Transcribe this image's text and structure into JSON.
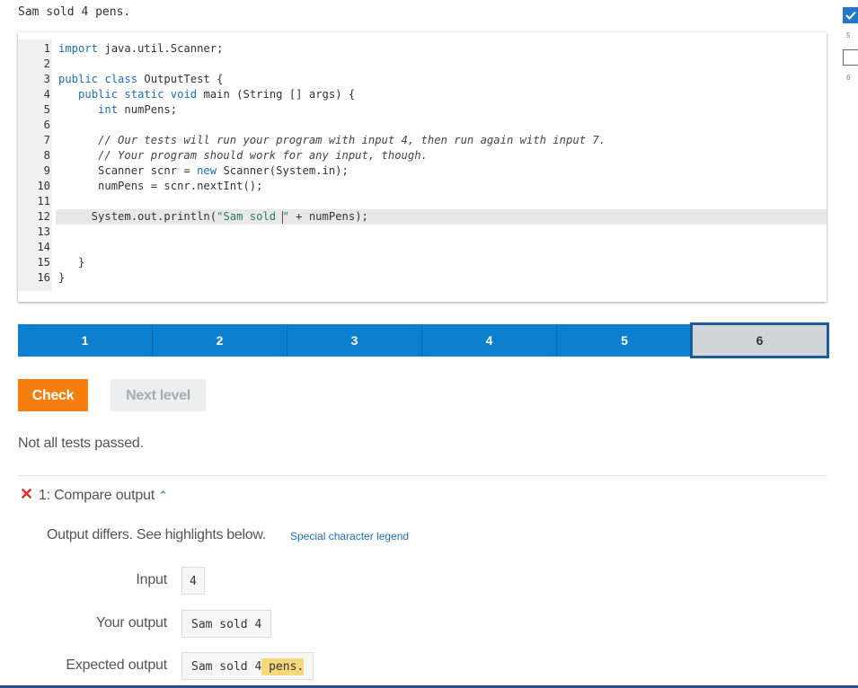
{
  "prompt": "Sam sold 4 pens.",
  "side_panel": {
    "items": [
      {
        "checked": true,
        "number": "5"
      },
      {
        "checked": false,
        "number": "6"
      }
    ]
  },
  "editor": {
    "lines": [
      {
        "n": "1",
        "code": "import java.util.Scanner;"
      },
      {
        "n": "2",
        "code": ""
      },
      {
        "n": "3",
        "code": "public class OutputTest {"
      },
      {
        "n": "4",
        "code": "   public static void main (String [] args) {"
      },
      {
        "n": "5",
        "code": "      int numPens;"
      },
      {
        "n": "6",
        "code": ""
      },
      {
        "n": "7",
        "code": "      // Our tests will run your program with input 4, then run again with input 7."
      },
      {
        "n": "8",
        "code": "      // Your program should work for any input, though."
      },
      {
        "n": "9",
        "code": "      Scanner scnr = new Scanner(System.in);"
      },
      {
        "n": "10",
        "code": "      numPens = scnr.nextInt();"
      },
      {
        "n": "11",
        "code": ""
      },
      {
        "n": "12",
        "code": "     System.out.println(\"Sam sold \" + numPens);"
      },
      {
        "n": "13",
        "code": ""
      },
      {
        "n": "14",
        "code": ""
      },
      {
        "n": "15",
        "code": "   }"
      },
      {
        "n": "16",
        "code": "}"
      }
    ],
    "active_line": "12"
  },
  "levels": {
    "items": [
      "1",
      "2",
      "3",
      "4",
      "5",
      "6"
    ],
    "current": "6"
  },
  "buttons": {
    "check": "Check",
    "next_level": "Next level"
  },
  "result": "Not all tests passed.",
  "test": {
    "title": "1: Compare output",
    "message": "Output differs. See highlights below.",
    "legend_link": "Special character legend",
    "input_label": "Input",
    "input_value": "4",
    "your_output_label": "Your output",
    "your_output_value": "Sam sold 4",
    "expected_label": "Expected output",
    "expected_value_prefix": "Sam sold 4",
    "expected_value_highlight": " pens."
  },
  "colors": {
    "accent": "#0c7fcf",
    "check_button": "#f47f0e",
    "error": "#e02d2d",
    "highlight": "#f7d87d"
  }
}
